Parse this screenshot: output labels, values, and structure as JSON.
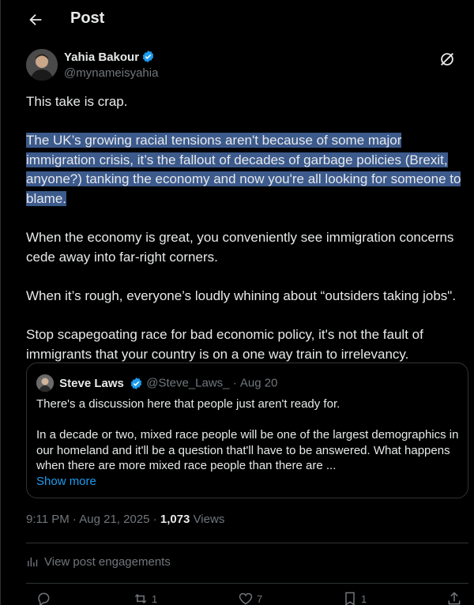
{
  "header": {
    "title": "Post"
  },
  "author": {
    "name": "Yahia Bakour",
    "handle": "@mynameisyahia"
  },
  "tweet": {
    "line1": "This take is crap.",
    "highlighted": "The UK’s growing racial tensions aren't because of some major immigration crisis, it’s the fallout of decades of garbage policies (Brexit, anyone?) tanking the economy and now you're all looking for someone to blame.",
    "para3": "When the economy is great, you conveniently see immigration concerns cede away into far-right corners.",
    "para4": "When it’s rough, everyone’s loudly whining about “outsiders taking jobs\".",
    "para5": "Stop scapegoating race for bad economic policy, it's not the fault of immigrants that your country is on a one way train to irrelevancy."
  },
  "quote": {
    "name": "Steve Laws",
    "handle": "@Steve_Laws_",
    "date": "Aug 20",
    "dot": "·",
    "text1": "There's a discussion here that people just aren't ready for.",
    "text2": "In a decade or two, mixed race people will be one of the largest demographics in our homeland and it'll be a question that'll have to be answered. What happens when there are more mixed race people than there are ...",
    "show_more": "Show more"
  },
  "meta": {
    "time": "9:11 PM",
    "date": "Aug 21, 2025",
    "views_count": "1,073",
    "views_label": "Views",
    "sep": "·"
  },
  "engagements": {
    "label": "View post engagements"
  },
  "actions": {
    "reply_count": "",
    "repost_count": "1",
    "like_count": "7",
    "bookmark_count": "1"
  },
  "colors": {
    "background": "#000000",
    "text": "#e7e9ea",
    "muted": "#71767b",
    "accent": "#1d9bf0",
    "highlight": "#3c5a8c",
    "border": "#2f3336"
  },
  "icons": {
    "back": "arrow-left-icon",
    "verified": "verified-badge-icon",
    "grok": "grok-icon",
    "engagements": "bar-chart-icon",
    "reply": "reply-icon",
    "repost": "repost-icon",
    "like": "heart-icon",
    "bookmark": "bookmark-icon",
    "share": "share-icon"
  }
}
